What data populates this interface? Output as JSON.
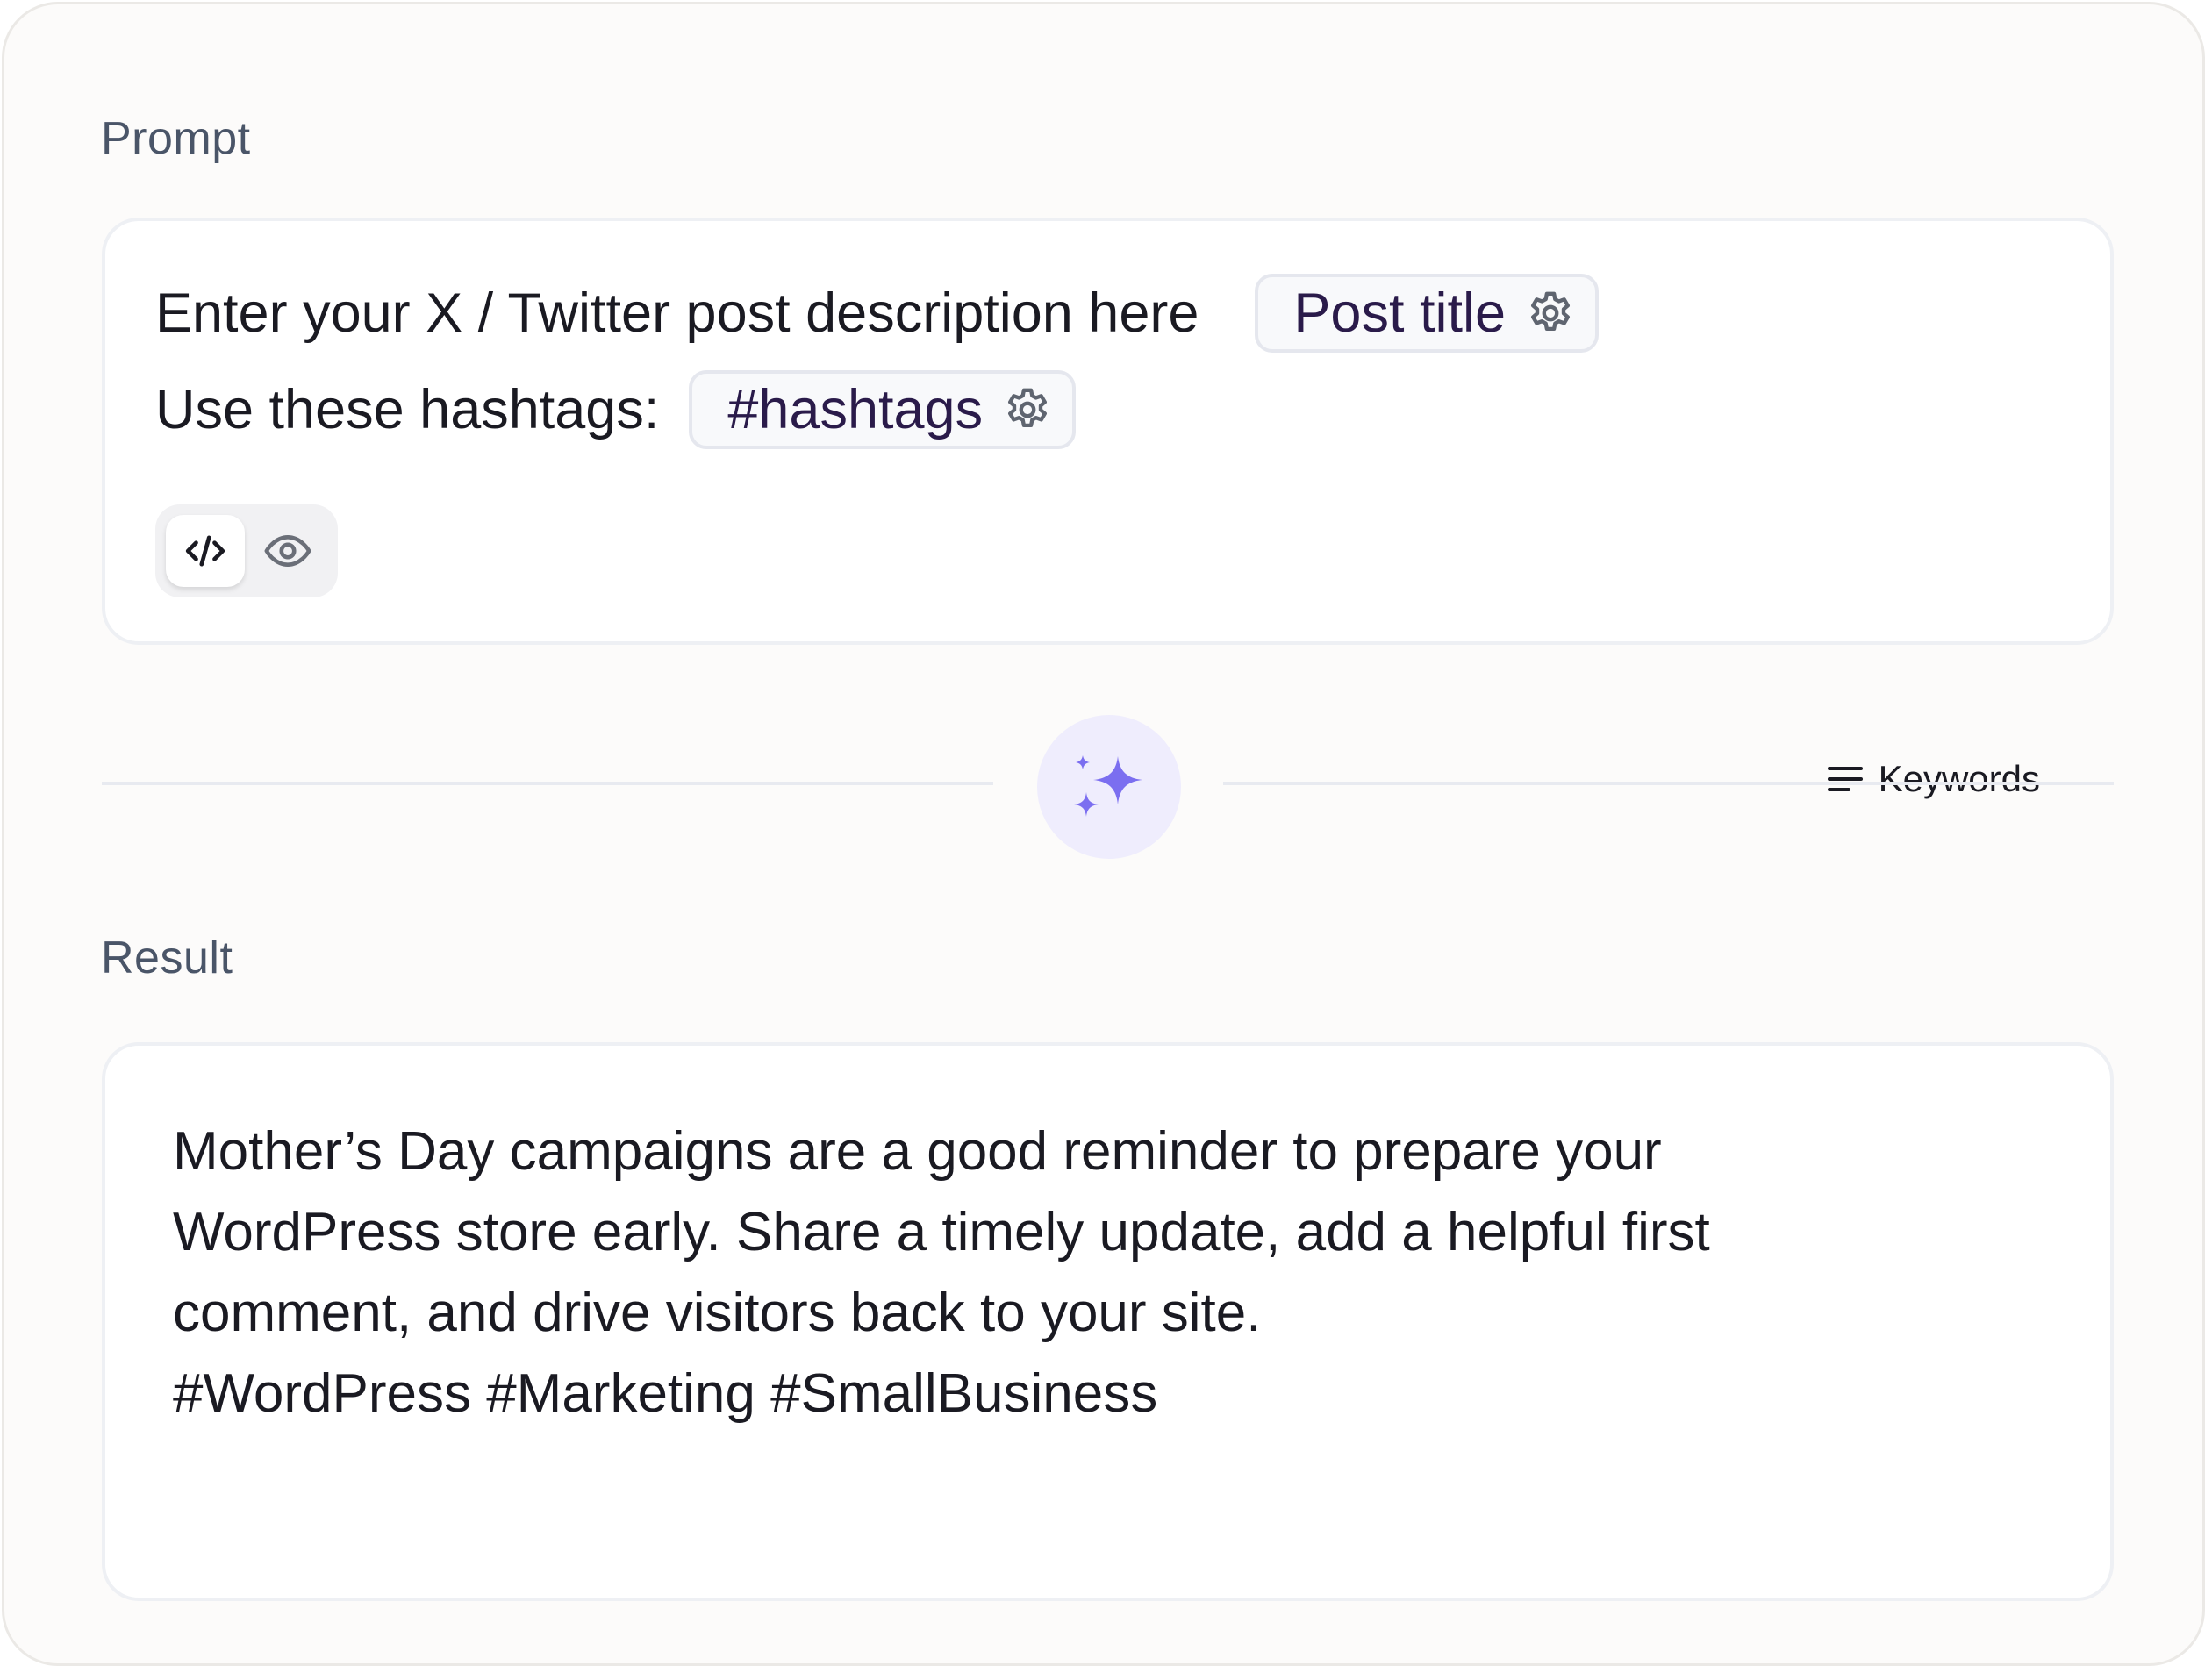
{
  "prompt": {
    "label": "Prompt",
    "line1_text": "Enter your X / Twitter post description here",
    "chip_post_title": "Post title",
    "line2_text": "Use these hashtags:",
    "chip_hashtags": "#hashtags",
    "keywords_label": "Keywords",
    "view_modes": [
      "code-icon",
      "eye-icon"
    ],
    "active_view_mode": "code"
  },
  "generate": {
    "icon": "sparkles-icon",
    "accent_color": "#7b6ef0",
    "background_color": "#efedfd"
  },
  "result": {
    "label": "Result",
    "lines": [
      "Mother’s Day campaigns are a good reminder to prepare your",
      "WordPress store early. Share a timely update, add a helpful first",
      "comment, and drive visitors back to your site.",
      "#WordPress #Marketing #SmallBusiness"
    ]
  }
}
